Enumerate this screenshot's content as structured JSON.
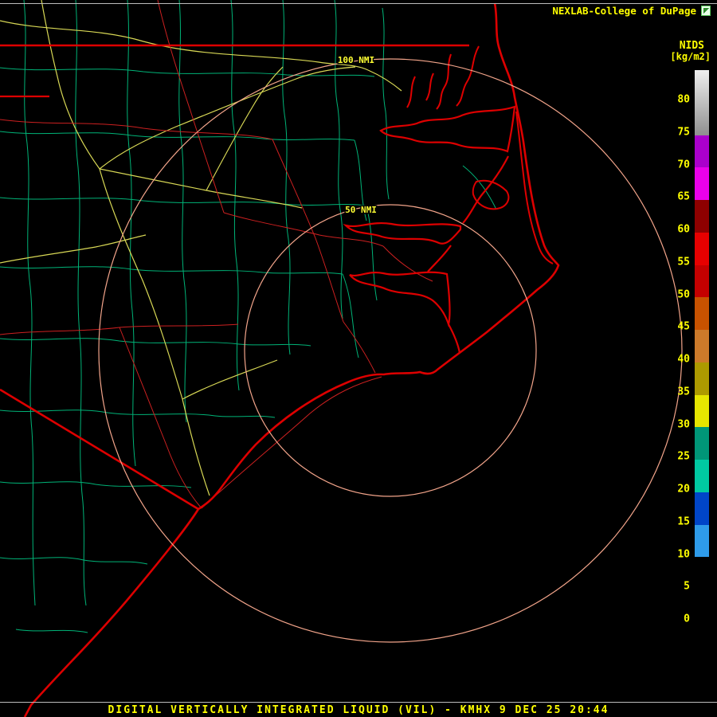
{
  "header": {
    "brand": "NEXLAB-College of DuPage",
    "product_code": "NIDS",
    "units": "[kg/m2]"
  },
  "rings": {
    "outer_label": "100 NMI",
    "inner_label": "50 NMI"
  },
  "colorbar": {
    "ticks": [
      "80",
      "75",
      "70",
      "65",
      "60",
      "55",
      "50",
      "45",
      "40",
      "35",
      "30",
      "25",
      "20",
      "15",
      "10",
      "5",
      "0"
    ],
    "segments": [
      {
        "band": "80-85",
        "color": "#efefef",
        "gradient_to": "#8f8f8f",
        "h": 2
      },
      {
        "band": "70-75",
        "color": "#aa00cc",
        "h": 1
      },
      {
        "band": "65-70",
        "color": "#ea00ea",
        "h": 1
      },
      {
        "band": "60-65",
        "color": "#8e0000",
        "h": 1
      },
      {
        "band": "55-60",
        "color": "#e60000",
        "h": 1
      },
      {
        "band": "50-55",
        "color": "#c40000",
        "h": 1
      },
      {
        "band": "45-50",
        "color": "#c85200",
        "h": 1
      },
      {
        "band": "40-45",
        "color": "#cd7a2a",
        "h": 1
      },
      {
        "band": "35-40",
        "color": "#ad9a00",
        "h": 1
      },
      {
        "band": "30-35",
        "color": "#e6e600",
        "h": 1
      },
      {
        "band": "25-30",
        "color": "#009678",
        "h": 1
      },
      {
        "band": "20-25",
        "color": "#00c9a2",
        "h": 1
      },
      {
        "band": "15-20",
        "color": "#0045c8",
        "h": 1
      },
      {
        "band": "10-15",
        "color": "#2e9bea",
        "h": 1
      },
      {
        "band": "5-10",
        "color": "#000000",
        "h": 1
      },
      {
        "band": "0-5",
        "color": "#000000",
        "h": 1
      }
    ]
  },
  "footer": {
    "caption": "DIGITAL VERTICALLY INTEGRATED LIQUID (VIL) - KMHX 9 DEC 25 20:44"
  },
  "colors": {
    "background": "#000000",
    "coastline": "#dd0000",
    "county_lines": "#00b377",
    "roads": "#d8d855",
    "highways": "#cc2020",
    "range_rings": "#f2a48a",
    "text": "#ffff00"
  }
}
